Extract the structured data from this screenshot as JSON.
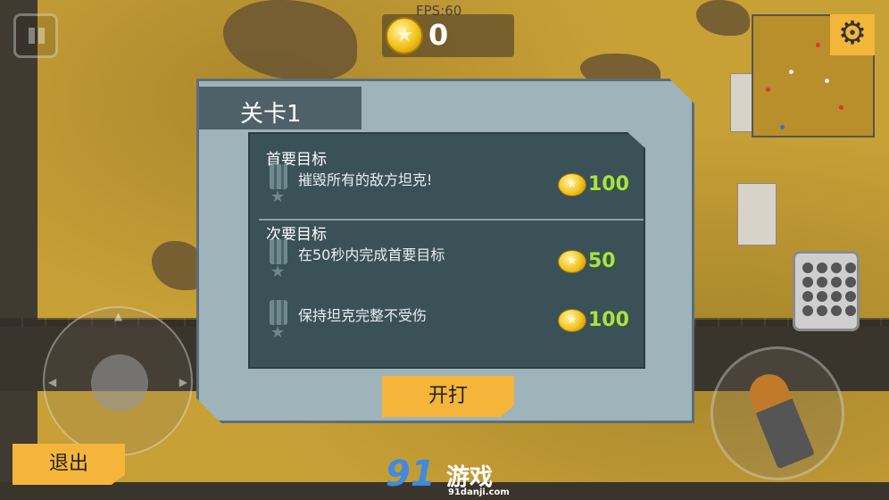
{
  "hud": {
    "fps": "FPS:60",
    "coins": "0",
    "pause_icon": "pause-icon",
    "settings_icon": "gear-icon"
  },
  "dialog": {
    "title": "关卡1",
    "primary": {
      "heading": "首要目标",
      "objectives": [
        {
          "text": "摧毁所有的敌方坦克!",
          "reward": "100"
        }
      ]
    },
    "secondary": {
      "heading": "次要目标",
      "objectives": [
        {
          "text": "在50秒内完成首要目标",
          "reward": "50"
        },
        {
          "text": "保持坦克完整不受伤",
          "reward": "100"
        }
      ]
    },
    "start_label": "开打"
  },
  "controls": {
    "exit_label": "退出",
    "fire_icon": "bullet-icon",
    "ammo_icon": "ammo-rack-icon"
  },
  "watermark": {
    "logo": "91",
    "name": "游戏",
    "url": "91danji.com"
  },
  "colors": {
    "accent": "#f4b53a",
    "dialog_bg": "#9fb3bb",
    "panel_bg": "#3b5158",
    "reward_green": "#a8e24a",
    "ground": "#c7a036"
  }
}
